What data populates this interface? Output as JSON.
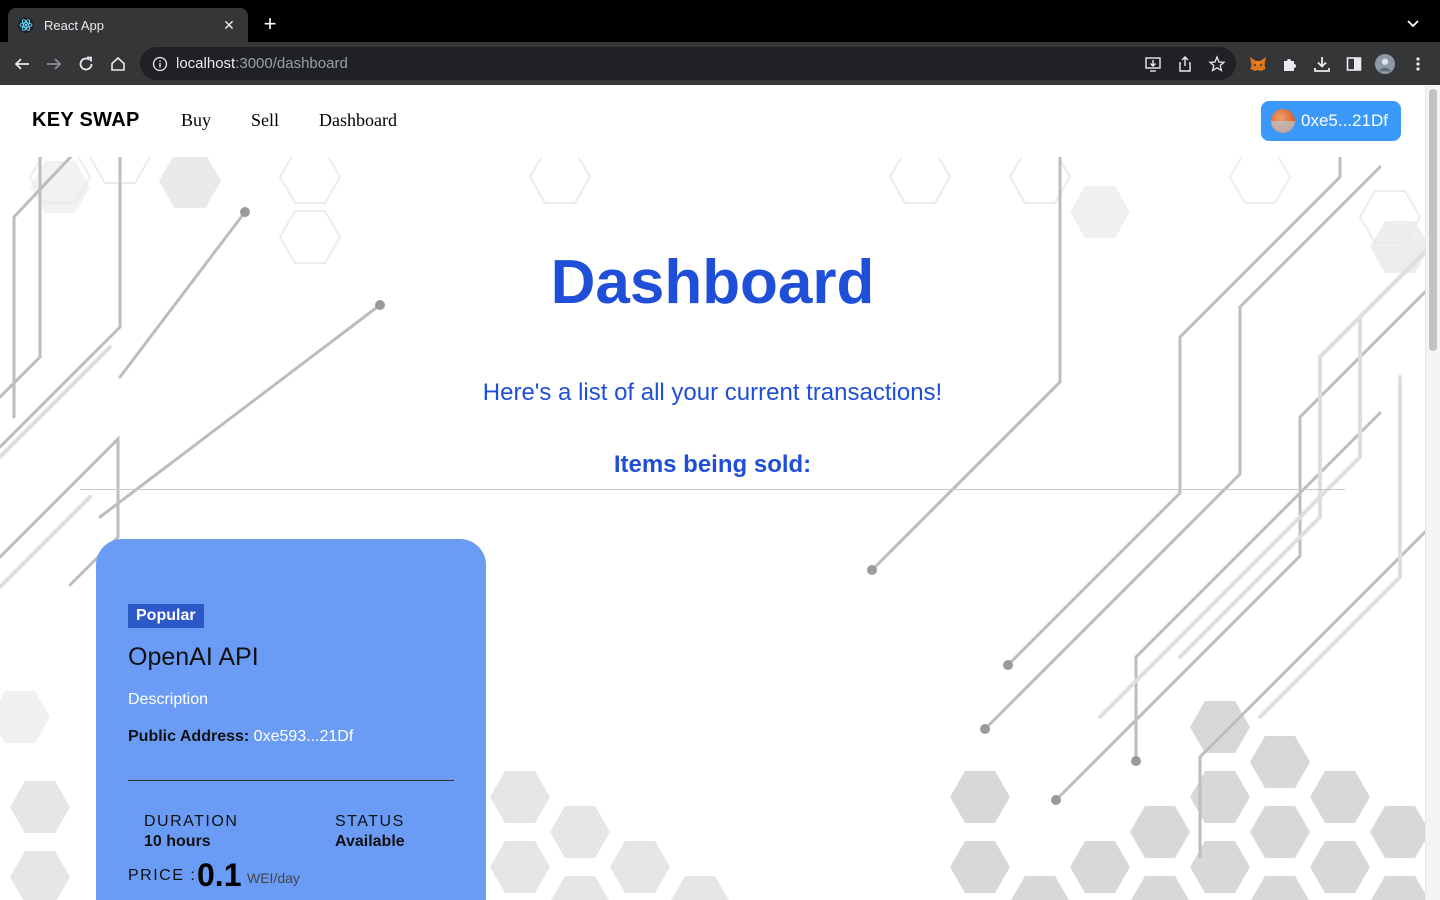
{
  "browser": {
    "tab_title": "React App",
    "url_host": "localhost",
    "url_path": ":3000/dashboard"
  },
  "navbar": {
    "brand": "KEY SWAP",
    "links": [
      "Buy",
      "Sell",
      "Dashboard"
    ],
    "wallet_label": "0xe5...21Df"
  },
  "main": {
    "title": "Dashboard",
    "subtitle": "Here's a list of all your current transactions!",
    "section_heading": "Items being sold:"
  },
  "listing": {
    "badge": "Popular",
    "name": "OpenAI API",
    "description": "Description",
    "address_label": "Public Address:",
    "address_value": "0xe593...21Df",
    "duration_label": "DURATION",
    "duration_value": "10 hours",
    "status_label": "STATUS",
    "status_value": "Available",
    "price_label": "PRICE :",
    "price_value": "0.1",
    "price_unit": "WEI/day"
  },
  "colors": {
    "accent": "#1f4fd8",
    "card": "#6a9cf6",
    "badge": "#2d59c8",
    "wallet_button": "#3b99fc"
  }
}
